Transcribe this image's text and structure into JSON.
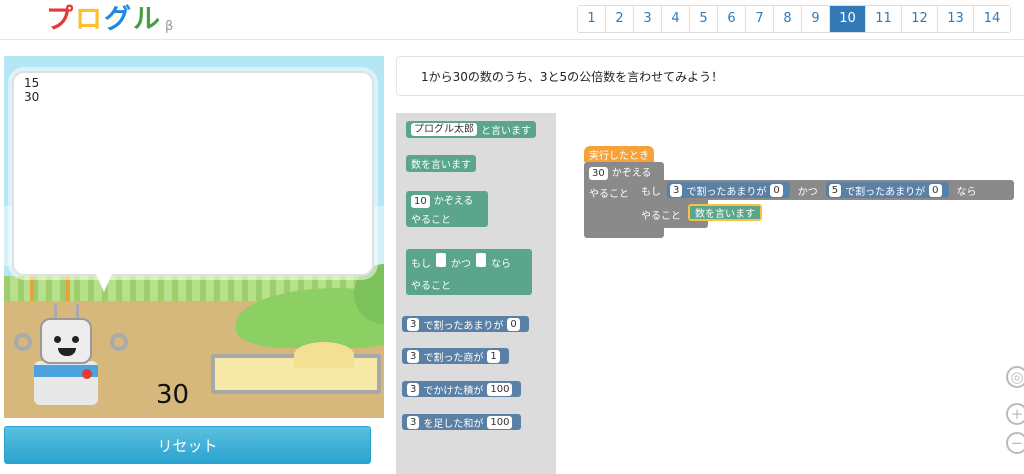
{
  "app": {
    "logo_chars": [
      "プ",
      "ロ",
      "グ",
      "ル"
    ],
    "logo_suffix": "β"
  },
  "pager": {
    "pages": [
      "1",
      "2",
      "3",
      "4",
      "5",
      "6",
      "7",
      "8",
      "9",
      "10",
      "11",
      "12",
      "13",
      "14"
    ],
    "active": "10"
  },
  "stage": {
    "speech_lines": [
      "15",
      "30"
    ],
    "counter": "30"
  },
  "reset_label": "リセット",
  "mission": "1から30の数のうち、3と5の公倍数を言わせてみよう！",
  "toolbox": {
    "say_name_value": "プログル太郎",
    "say_name_suffix": "と言います",
    "say_number": "数を言います",
    "count_value": "10",
    "count_suffix": "かぞえる",
    "do_label": "やること",
    "if_label": "もし",
    "and_label": "かつ",
    "then_label": "なら",
    "remainder_a": "3",
    "remainder_text": "で割ったあまりが",
    "remainder_b": "0",
    "quotient_a": "3",
    "quotient_text": "で割った商が",
    "quotient_b": "1",
    "product_a": "3",
    "product_text": "でかけた積が",
    "product_b": "100",
    "sum_a": "3",
    "sum_text": "を足した和が",
    "sum_b": "100"
  },
  "program": {
    "on_run": "実行したとき",
    "count_value": "30",
    "count_suffix": "かぞえる",
    "do_label": "やること",
    "if_label": "もし",
    "cond1_a": "3",
    "cond1_text": "で割ったあまりが",
    "cond1_b": "0",
    "and_label": "かつ",
    "cond2_a": "5",
    "cond2_text": "で割ったあまりが",
    "cond2_b": "0",
    "then_label": "なら",
    "inner_do_label": "やること",
    "inner_action": "数を言います"
  },
  "zoom": {
    "center_icon": "target-icon",
    "in": "+",
    "out": "−"
  },
  "colors": {
    "accent": "#337ab7",
    "toolbox_green": "#5ba58c",
    "toolbox_blue": "#5b80a5",
    "event_orange": "#f7a13b"
  }
}
